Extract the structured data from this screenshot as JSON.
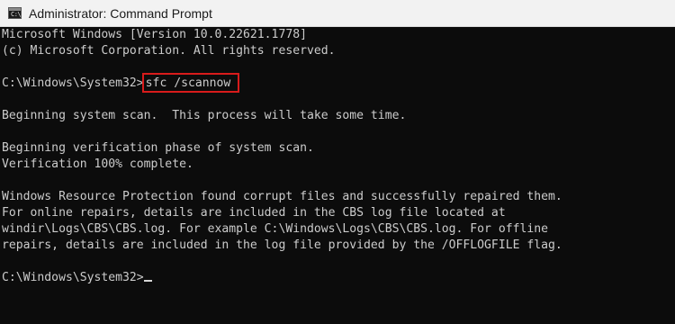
{
  "window": {
    "title": "Administrator: Command Prompt",
    "icon": "cmd-icon",
    "icon_glyph": "C:\\",
    "background": "#0c0c0c",
    "text_color": "#cccccc",
    "highlight_color": "#d81b1b"
  },
  "console": {
    "header_lines": [
      "Microsoft Windows [Version 10.0.22621.1778]",
      "(c) Microsoft Corporation. All rights reserved."
    ],
    "prompt": "C:\\Windows\\System32>",
    "command": "sfc /scannow",
    "output": [
      "Beginning system scan.  This process will take some time.",
      "Beginning verification phase of system scan.",
      "Verification 100% complete.",
      "Windows Resource Protection found corrupt files and successfully repaired them.",
      "For online repairs, details are included in the CBS log file located at",
      "windir\\Logs\\CBS\\CBS.log. For example C:\\Windows\\Logs\\CBS\\CBS.log. For offline",
      "repairs, details are included in the log file provided by the /OFFLOGFILE flag."
    ],
    "final_prompt": "C:\\Windows\\System32>"
  }
}
